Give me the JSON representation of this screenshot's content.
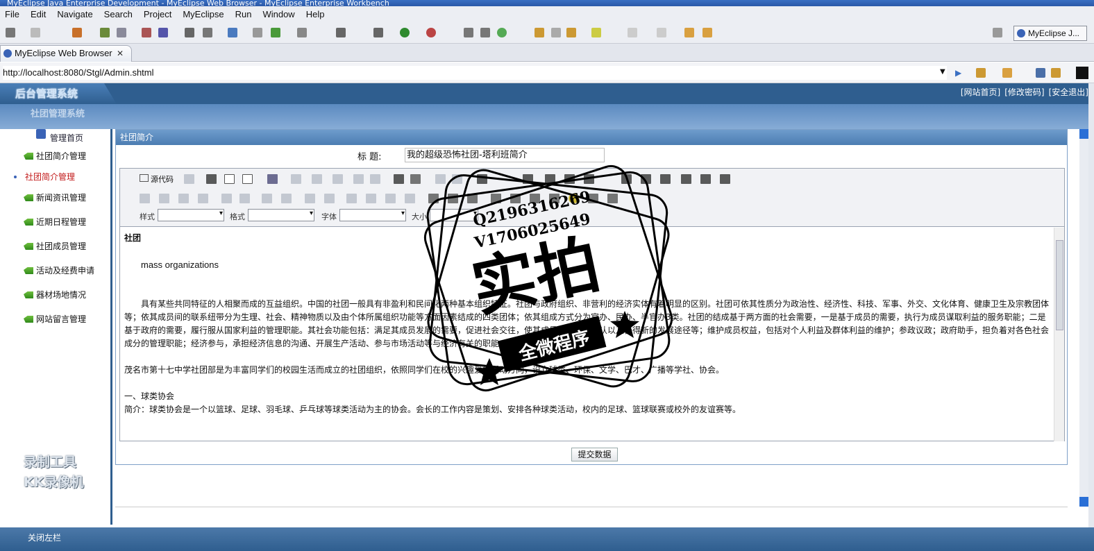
{
  "window": {
    "title": "MyEclipse Java Enterprise Development - MyEclipse Web Browser - MyEclipse Enterprise Workbench"
  },
  "menu": [
    "File",
    "Edit",
    "Navigate",
    "Search",
    "Project",
    "MyEclipse",
    "Run",
    "Window",
    "Help"
  ],
  "perspective": "MyEclipse J...",
  "browser_tab": {
    "label": "MyEclipse Web Browser",
    "close": "✕"
  },
  "url": "http://localhost:8080/Stgl/Admin.shtml",
  "app": {
    "logo": "后台管理系统",
    "top_links": [
      "[网站首页]",
      "[修改密码]",
      "[安全退出]"
    ],
    "sub_title": "社团管理系统",
    "home": "管理首页"
  },
  "sidebar": {
    "items": [
      "社团简介管理",
      "社团简介管理",
      "新闻资讯管理",
      "近期日程管理",
      "社团成员管理",
      "活动及经费申请",
      "器材场地情况",
      "网站留言管理"
    ],
    "active_index": 1
  },
  "watermark": {
    "line1": "录制工具",
    "line2": "KK录像机"
  },
  "panel": {
    "header": "社团简介",
    "title_label": "标 题:",
    "title_value": "我的超级恐怖社团-塔利班简介"
  },
  "editor": {
    "source_label": "源代码",
    "style_label": "样式",
    "format_label": "格式",
    "font_label": "字体",
    "size_label": "大小",
    "heading": "社团",
    "english": "mass organizations",
    "para1": "具有某些共同特征的人相聚而成的互益组织。中国的社团一般具有非盈利和民间化两种基本组织特征。社团与政府组织、非营利的经济实体有着明显的区别。社团可依其性质分为政治性、经济性、科技、军事、外交、文化体育、健康卫生及宗教团体等；依其成员间的联系纽带分为生理、社会、精神物质以及由个体所属组织功能等方面因素结成的四类团体；依其组成方式分为官办、民办、半官办3类。社团的结成基于两方面的社会需要，一是基于成员的需要，执行为成员谋取利益的服务职能；二是基于政府的需要，履行服从国家利益的管理职能。其社会功能包括：满足其成员发展的需要，促进社会交往，使其成员获得社会承认以及获得新的发展途径等；维护成员权益，包括对个人利益及群体利益的维护；参政议政；政府助手，担负着对各色社会成分的管理职能；经济参与，承担经济信息的沟通、开展生产活动、参与市场活动等与经济有关的职能。",
    "para2": "茂名市第十七中学社团部是为丰富同学们的校园生活而成立的社团组织，依照同学们在校的兴趣爱好活动方向，设立球类、环保、文学、巴才、广播等学社、协会。",
    "para3": "一、球类协会",
    "para4": "简介：球类协会是一个以篮球、足球、羽毛球、乒乓球等球类活动为主的协会。会长的工作内容是策划、安排各种球类活动，校内的足球、篮球联赛或校外的友谊赛等。"
  },
  "submit_label": "提交数据",
  "stamp": {
    "qq": "Q2196316269",
    "vx": "V1706025649",
    "big": "实拍",
    "banner": "全微程序"
  },
  "footer": "关闭左栏"
}
